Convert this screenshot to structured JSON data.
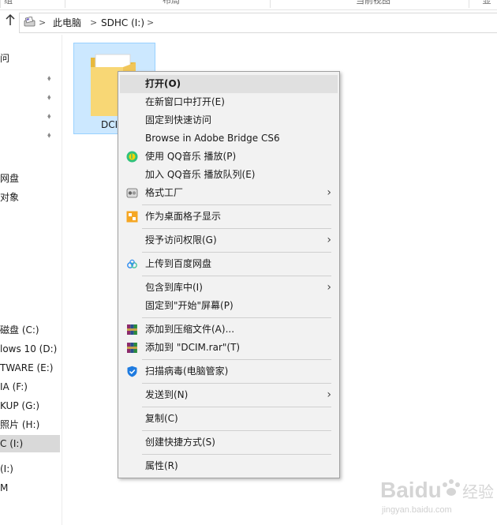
{
  "ribbon": {
    "tabs": [
      "组",
      "布局",
      "当前视图",
      "显"
    ]
  },
  "address": {
    "breadcrumbs": [
      "此电脑",
      "SDHC (I:)"
    ],
    "separator": ">"
  },
  "nav": {
    "quick_access_partial": "问",
    "items": [
      {
        "label": "网盘"
      },
      {
        "label": "对象"
      },
      {
        "label": "磁盘 (C:)"
      },
      {
        "label": "lows 10 (D:)"
      },
      {
        "label": "TWARE (E:)"
      },
      {
        "label": "IA (F:)"
      },
      {
        "label": "KUP (G:)"
      },
      {
        "label": "照片 (H:)"
      },
      {
        "label": "C (I:)",
        "selected": true
      },
      {
        "label": "(I:)"
      },
      {
        "label": "M"
      }
    ]
  },
  "content": {
    "folder_label": "DCIM"
  },
  "context_menu": {
    "items": [
      {
        "label": "打开(O)",
        "bold": true,
        "highlight": true
      },
      {
        "label": "在新窗口中打开(E)"
      },
      {
        "label": "固定到快速访问"
      },
      {
        "label": "Browse in Adobe Bridge CS6"
      },
      {
        "label": "使用 QQ音乐 播放(P)",
        "icon": "qq-music-icon"
      },
      {
        "label": "加入 QQ音乐 播放队列(E)"
      },
      {
        "label": "格式工厂",
        "icon": "format-factory-icon",
        "submenu": true
      },
      {
        "label": "作为桌面格子显示",
        "icon": "desktop-grid-icon"
      },
      {
        "label": "授予访问权限(G)",
        "submenu": true
      },
      {
        "label": "上传到百度网盘",
        "icon": "baidu-cloud-icon"
      },
      {
        "label": "包含到库中(I)",
        "submenu": true
      },
      {
        "label": "固定到\"开始\"屏幕(P)"
      },
      {
        "label": "添加到压缩文件(A)...",
        "icon": "winrar-icon"
      },
      {
        "label": "添加到 \"DCIM.rar\"(T)",
        "icon": "winrar-icon"
      },
      {
        "label": "扫描病毒(电脑管家)",
        "icon": "shield-icon"
      },
      {
        "label": "发送到(N)",
        "submenu": true
      },
      {
        "label": "复制(C)"
      },
      {
        "label": "创建快捷方式(S)"
      },
      {
        "label": "属性(R)"
      }
    ]
  },
  "watermark": {
    "brand": "Baidu",
    "suffix": "经验",
    "url": "jingyan.baidu.com"
  },
  "colors": {
    "accent_selection": "#cce8ff",
    "menu_bg": "#f2f2f2",
    "menu_highlight": "#e0e0e0",
    "qq_music_green": "#31c27c",
    "qq_music_yellow": "#ffd400",
    "shield_blue": "#1e7be0",
    "desktop_grid_orange": "#f5a623"
  }
}
